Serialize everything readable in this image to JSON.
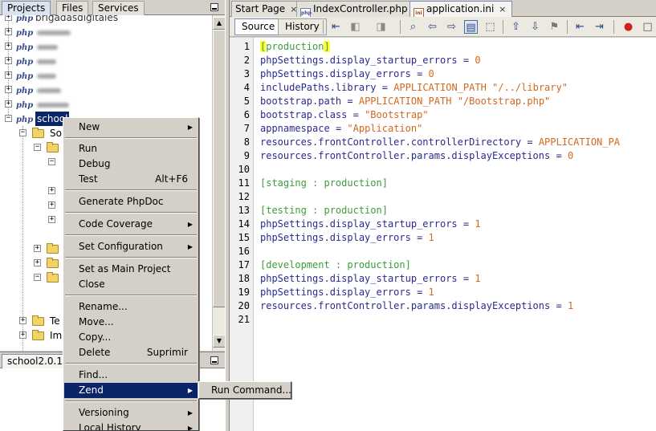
{
  "left_panel": {
    "tabs": [
      {
        "label": "Projects",
        "active": true
      },
      {
        "label": "Files",
        "active": false
      },
      {
        "label": "Services",
        "active": false
      }
    ],
    "tree": {
      "projects_top_label": "brigadasdigitales",
      "selected_project_label": "school",
      "sub_labels": [
        "So",
        "Te",
        "Im"
      ]
    },
    "navigator_tab": "school2.0.1 -"
  },
  "editor": {
    "file_tabs": [
      {
        "label": "Start Page",
        "icon": "start-page-icon",
        "active": false
      },
      {
        "label": "IndexController.php",
        "icon": "php-file-icon",
        "active": false
      },
      {
        "label": "application.ini",
        "icon": "ini-file-icon",
        "active": true
      }
    ],
    "view_tabs": {
      "source": "Source",
      "history": "History"
    },
    "toolbar_icons": [
      "last-edit-icon",
      "back-icon",
      "forward-icon",
      "find-icon",
      "find-previous-icon",
      "find-next-icon",
      "toggle-highlight-icon",
      "toggle-rect-select-icon",
      "previous-bookmark-icon",
      "next-bookmark-icon",
      "toggle-bookmark-icon",
      "shift-left-icon",
      "shift-right-icon",
      "record-macro-icon",
      "stop-macro-icon"
    ],
    "line_numbers": [
      "1",
      "2",
      "3",
      "4",
      "5",
      "6",
      "7",
      "8",
      "9",
      "10",
      "11",
      "12",
      "13",
      "14",
      "15",
      "16",
      "17",
      "18",
      "19",
      "20",
      "21"
    ],
    "code": {
      "l1_section": "production",
      "l2_key": "phpSettings.display_startup_errors",
      "l2_val": "0",
      "l3_key": "phpSettings.display_errors",
      "l3_val": "0",
      "l4_key": "includePaths.library",
      "l4_const": "APPLICATION_PATH",
      "l4_str": "\"/../library\"",
      "l5_key": "bootstrap.path",
      "l5_const": "APPLICATION_PATH",
      "l5_str": "\"/Bootstrap.php\"",
      "l6_key": "bootstrap.class",
      "l6_str": "\"Bootstrap\"",
      "l7_key": "appnamespace",
      "l7_str": "\"Application\"",
      "l8_key": "resources.frontController.controllerDirectory",
      "l8_const": "APPLICATION_PA",
      "l9_key": "resources.frontController.params.displayExceptions",
      "l9_val": "0",
      "l11_section": "[staging : production]",
      "l13_section": "[testing : production]",
      "l14_key": "phpSettings.display_startup_errors",
      "l14_val": "1",
      "l15_key": "phpSettings.display_errors",
      "l15_val": "1",
      "l17_section": "[development : production]",
      "l18_key": "phpSettings.display_startup_errors",
      "l18_val": "1",
      "l19_key": "phpSettings.display_errors",
      "l19_val": "1",
      "l20_key": "resources.frontController.params.displayExceptions",
      "l20_val": "1",
      "op": "="
    }
  },
  "context_menu": {
    "items": [
      {
        "label": "New",
        "submenu": true
      },
      {
        "label": "Run"
      },
      {
        "label": "Debug"
      },
      {
        "label": "Test",
        "shortcut": "Alt+F6"
      },
      {
        "label": "Generate PhpDoc"
      },
      {
        "label": "Code Coverage",
        "submenu": true
      },
      {
        "label": "Set Configuration",
        "submenu": true
      },
      {
        "label": "Set as Main Project"
      },
      {
        "label": "Close"
      },
      {
        "label": "Rename..."
      },
      {
        "label": "Move..."
      },
      {
        "label": "Copy..."
      },
      {
        "label": "Delete",
        "shortcut": "Suprimir"
      },
      {
        "label": "Find..."
      },
      {
        "label": "Zend",
        "submenu": true,
        "highlighted": true
      },
      {
        "label": "Versioning",
        "submenu": true
      },
      {
        "label": "Local History",
        "submenu": true
      }
    ],
    "zend_submenu": [
      {
        "label": "Run Command..."
      }
    ]
  },
  "colors": {
    "selection": "#0a246a",
    "section": "#3b9c3b",
    "value": "#d2691e",
    "key": "#2a2a90",
    "bracket_highlight": "#ffff33"
  }
}
